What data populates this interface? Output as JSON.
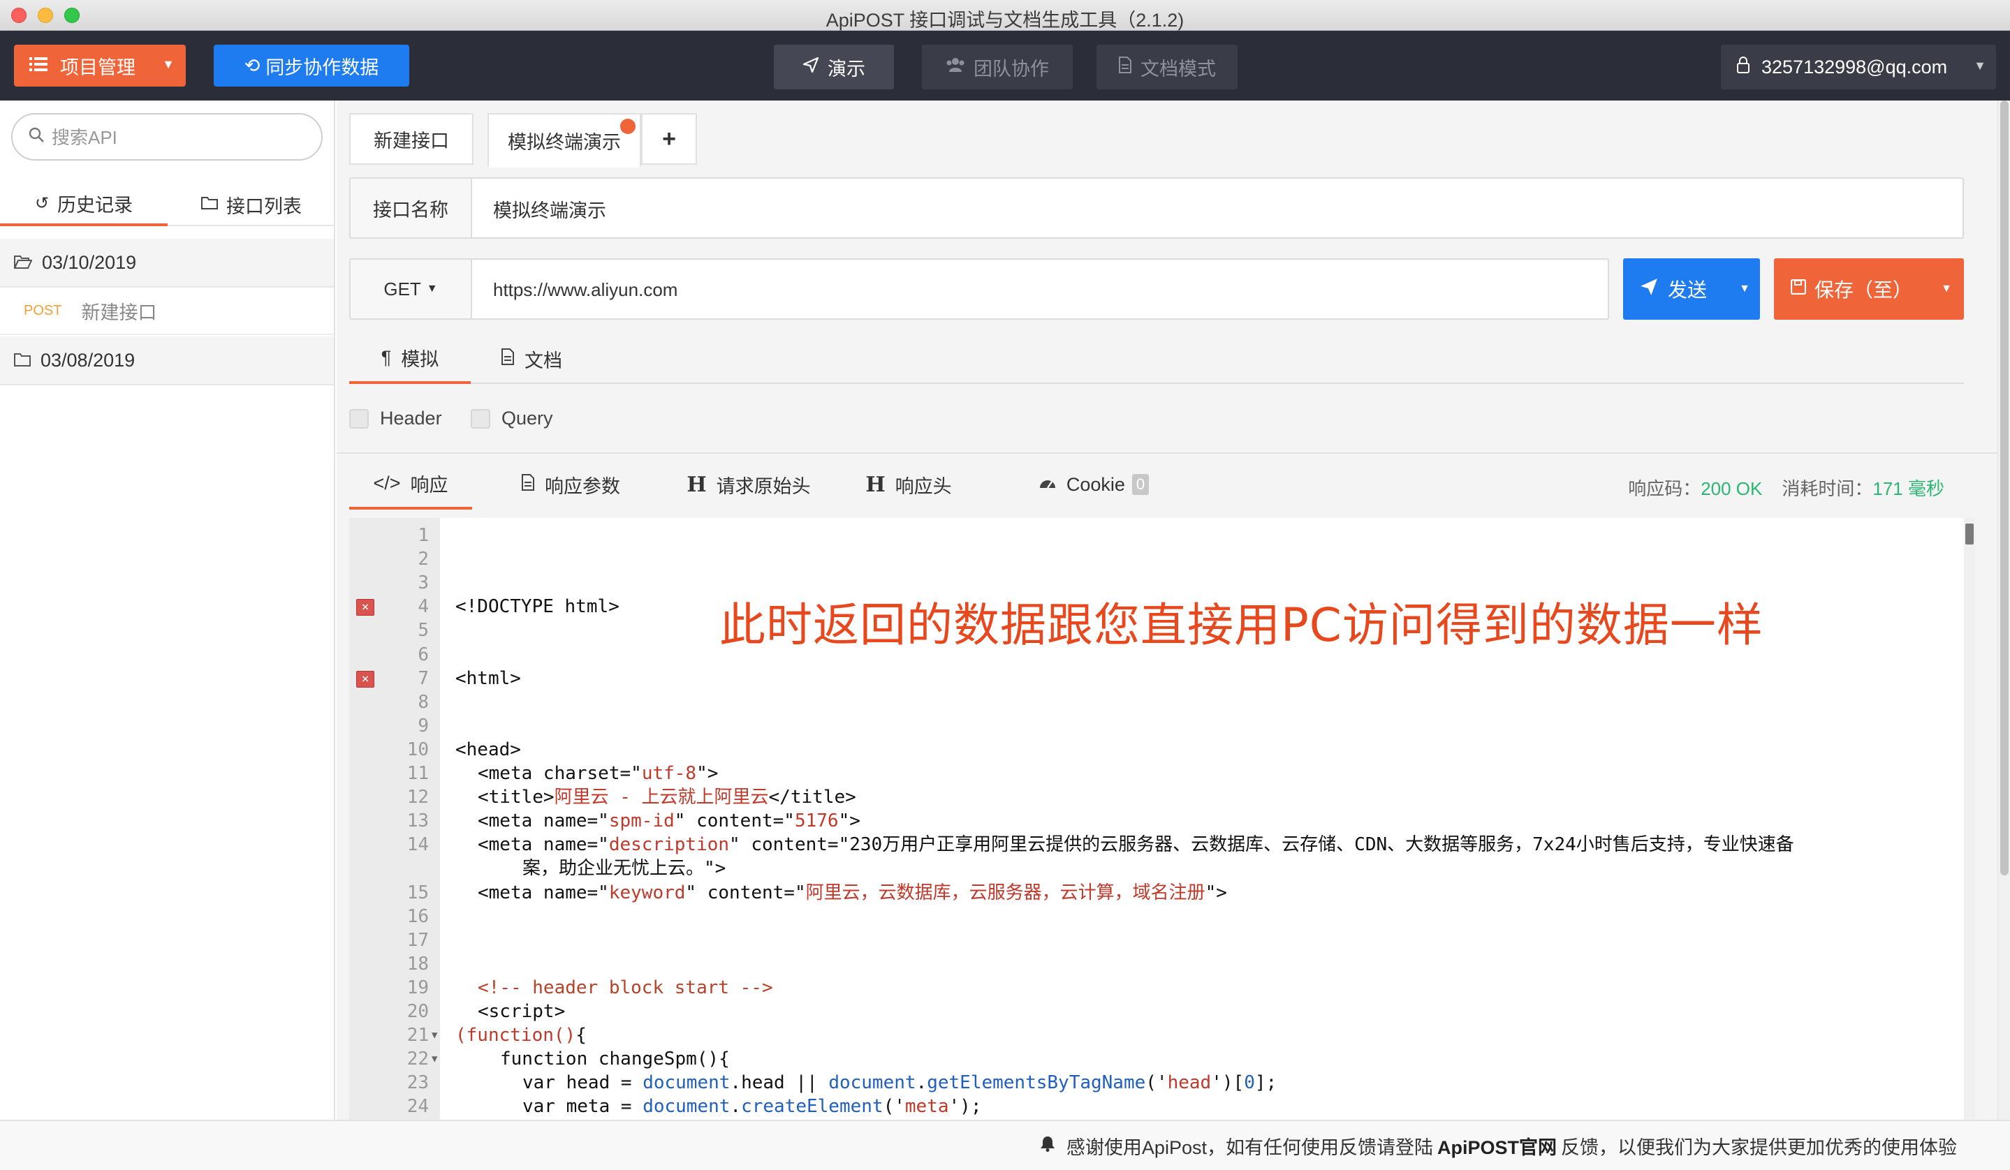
{
  "window": {
    "title": "ApiPOST 接口调试与文档生成工具（2.1.2)"
  },
  "topnav": {
    "project_label": "项目管理",
    "sync_label": "同步协作数据",
    "tabs": [
      {
        "label": "演示",
        "icon": "paper-plane-icon"
      },
      {
        "label": "团队协作",
        "icon": "users-icon"
      },
      {
        "label": "文档模式",
        "icon": "document-icon"
      }
    ],
    "user": "3257132998@qq.com"
  },
  "sidebar": {
    "search_placeholder": "搜索API",
    "tabs": [
      {
        "label": "历史记录",
        "icon": "history-icon"
      },
      {
        "label": "接口列表",
        "icon": "folder-icon"
      }
    ],
    "groups": [
      {
        "date": "03/10/2019",
        "items": [
          {
            "method": "POST",
            "name": "新建接口"
          }
        ]
      },
      {
        "date": "03/08/2019",
        "items": []
      }
    ]
  },
  "tabs": {
    "items": [
      {
        "label": "新建接口"
      },
      {
        "label": "模拟终端演示"
      }
    ],
    "add": "+"
  },
  "request": {
    "name_label": "接口名称",
    "name_value": "模拟终端演示",
    "method": "GET",
    "url": "https://www.aliyun.com",
    "send_label": "发送",
    "save_label": "保存（至）"
  },
  "mode_tabs": [
    {
      "label": "模拟",
      "icon": "pilcrow-icon"
    },
    {
      "label": "文档",
      "icon": "document-icon"
    }
  ],
  "checks": [
    {
      "label": "Header"
    },
    {
      "label": "Query"
    }
  ],
  "response": {
    "tabs": [
      {
        "label": "响应",
        "icon": "code-icon"
      },
      {
        "label": "响应参数",
        "icon": "document-icon"
      },
      {
        "label": "请求原始头",
        "icon": "H"
      },
      {
        "label": "响应头",
        "icon": "H"
      },
      {
        "label": "Cookie",
        "icon": "dashboard-icon",
        "badge": "0"
      }
    ],
    "status_label": "响应码：",
    "status_value": "200 OK",
    "time_label": "消耗时间：",
    "time_value": "171 毫秒"
  },
  "code": {
    "lines": [
      {
        "n": "1",
        "t": ""
      },
      {
        "n": "2",
        "t": ""
      },
      {
        "n": "3",
        "t": ""
      },
      {
        "n": "4",
        "t": "<!DOCTYPE html>",
        "err": true
      },
      {
        "n": "5",
        "t": ""
      },
      {
        "n": "6",
        "t": ""
      },
      {
        "n": "7",
        "t": "<html>",
        "err": true
      },
      {
        "n": "8",
        "t": ""
      },
      {
        "n": "9",
        "t": ""
      },
      {
        "n": "10",
        "t": "<head>"
      },
      {
        "n": "11",
        "t": "<meta charset=\"utf-8\">"
      },
      {
        "n": "12",
        "t": "<title>阿里云 - 上云就上阿里云</title>"
      },
      {
        "n": "13",
        "t": "<meta name=\"spm-id\" content=\"5176\">"
      },
      {
        "n": "14",
        "t": "<meta name=\"description\" content=\"230万用户正享用阿里云提供的云服务器、云数据库、云存储、CDN、大数据等服务，7x24小时售后支持，专业快速备"
      },
      {
        "n": "",
        "t": "案，助企业无忧上云。\">"
      },
      {
        "n": "15",
        "t": "<meta name=\"keyword\" content=\"阿里云，云数据库，云服务器，云计算，域名注册\">"
      },
      {
        "n": "16",
        "t": ""
      },
      {
        "n": "17",
        "t": ""
      },
      {
        "n": "18",
        "t": ""
      },
      {
        "n": "19",
        "t": "<!-- header block start -->"
      },
      {
        "n": "20",
        "t": "<script>"
      },
      {
        "n": "21",
        "t": "(function(){"
      },
      {
        "n": "22",
        "t": "function changeSpm(){"
      },
      {
        "n": "23",
        "t": "var head = document.head || document.getElementsByTagName('head')[0];"
      },
      {
        "n": "24",
        "t": "var meta = document.createElement('meta');"
      }
    ]
  },
  "overlay_note": "此时返回的数据跟您直接用PC访问得到的数据一样",
  "statusbar": {
    "prefix": "感谢使用ApiPost，如有任何使用反馈请登陆",
    "link": "ApiPOST官网",
    "suffix": "反馈，以便我们为大家提供更加优秀的使用体验"
  }
}
